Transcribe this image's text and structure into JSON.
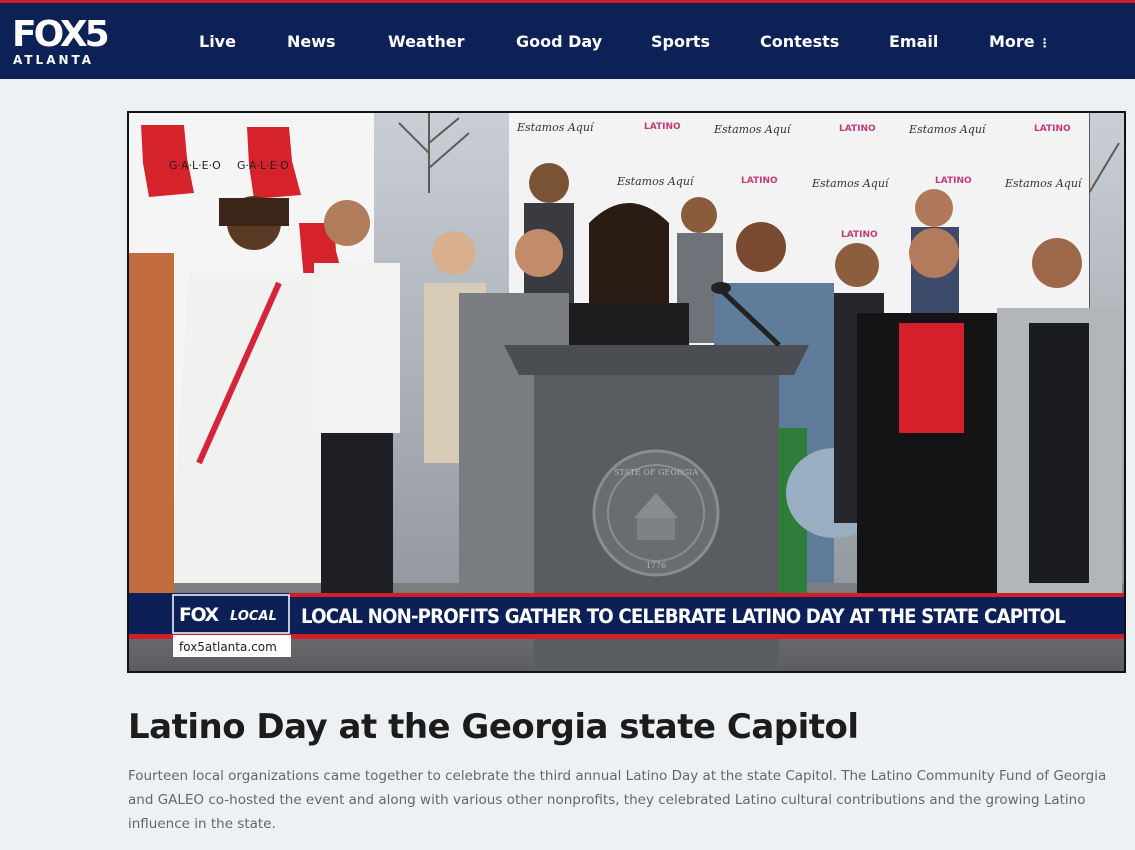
{
  "site": {
    "logo_main": "FOX5",
    "logo_sub": "ATLANTA"
  },
  "nav": {
    "items": [
      {
        "label": "Live"
      },
      {
        "label": "News"
      },
      {
        "label": "Weather"
      },
      {
        "label": "Good Day"
      },
      {
        "label": "Sports"
      },
      {
        "label": "Contests"
      },
      {
        "label": "Email"
      },
      {
        "label": "More"
      }
    ],
    "more_icon": "vertical-dots-icon"
  },
  "video": {
    "bug_brand": "FOX",
    "bug_brand_sub": "LOCAL",
    "lower_third_headline": "LOCAL NON-PROFITS GATHER TO CELEBRATE LATINO DAY AT THE STATE CAPITOL",
    "url_tag": "fox5atlanta.com",
    "backdrop_text": "Estamos Aquí",
    "backdrop_logo": "LATINO",
    "galeo_text": "G·A·L·E·O",
    "seal_text": "STATE OF GEORGIA",
    "seal_year": "1776"
  },
  "article": {
    "headline": "Latino Day at the Georgia state Capitol",
    "summary": "Fourteen local organizations came together to celebrate the third annual Latino Day at the state Capitol. The Latino Community Fund of Georgia and GALEO co-hosted the event and along with various other nonprofits, they celebrated Latino cultural contributions and the growing Latino influence in the state."
  },
  "colors": {
    "header_bg": "#0c2257",
    "accent_red": "#d11f2a",
    "page_bg": "#eef1f4"
  }
}
